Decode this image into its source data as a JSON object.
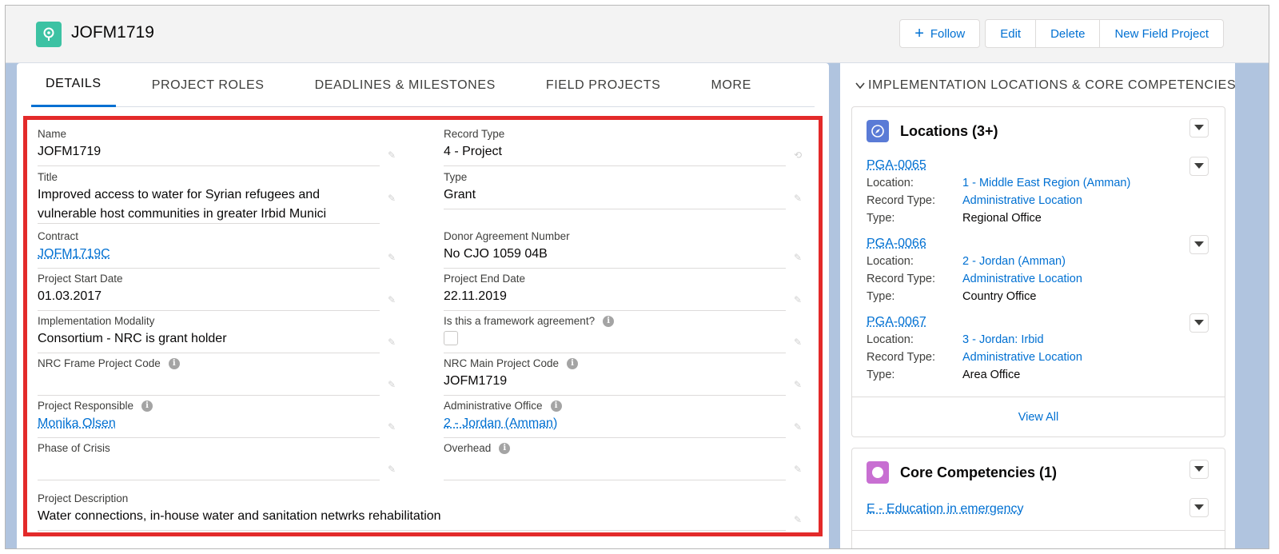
{
  "header": {
    "title": "JOFM1719",
    "buttons": {
      "follow": "Follow",
      "edit": "Edit",
      "delete": "Delete",
      "new_field_project": "New Field Project"
    }
  },
  "tabs": [
    "DETAILS",
    "PROJECT ROLES",
    "DEADLINES & MILESTONES",
    "FIELD PROJECTS",
    "MORE"
  ],
  "details": {
    "name": {
      "label": "Name",
      "value": "JOFM1719"
    },
    "record_type": {
      "label": "Record Type",
      "value": "4 - Project"
    },
    "title": {
      "label": "Title",
      "value_line1": "Improved access to water for Syrian refugees and",
      "value_line2": "vulnerable host communities in greater Irbid Munici"
    },
    "type": {
      "label": "Type",
      "value": "Grant"
    },
    "contract": {
      "label": "Contract",
      "value": "JOFM1719C"
    },
    "donor_agreement_number": {
      "label": "Donor Agreement Number",
      "value": "No CJO 1059 04B"
    },
    "project_start_date": {
      "label": "Project Start Date",
      "value": "01.03.2017"
    },
    "project_end_date": {
      "label": "Project End Date",
      "value": "22.11.2019"
    },
    "implementation_modality": {
      "label": "Implementation Modality",
      "value": "Consortium - NRC is grant holder"
    },
    "framework_agreement": {
      "label": "Is this a framework agreement?",
      "checked": false
    },
    "nrc_frame_project_code": {
      "label": "NRC Frame Project Code",
      "value": ""
    },
    "nrc_main_project_code": {
      "label": "NRC Main Project Code",
      "value": "JOFM1719"
    },
    "project_responsible": {
      "label": "Project Responsible",
      "value": "Monika Olsen"
    },
    "administrative_office": {
      "label": "Administrative Office",
      "value": "2 - Jordan (Amman)"
    },
    "phase_of_crisis": {
      "label": "Phase of Crisis",
      "value": ""
    },
    "overhead": {
      "label": "Overhead",
      "value": ""
    },
    "project_description": {
      "label": "Project Description",
      "value": "Water connections, in-house water and sanitation netwrks rehabilitation"
    }
  },
  "right": {
    "section_title": "IMPLEMENTATION LOCATIONS & CORE COMPETENCIES",
    "locations": {
      "title": "Locations (3+)",
      "labels": {
        "location": "Location:",
        "record_type": "Record Type:",
        "type": "Type:"
      },
      "items": [
        {
          "id": "PGA-0065",
          "location": "1 - Middle East Region (Amman)",
          "record_type": "Administrative Location",
          "type": "Regional Office"
        },
        {
          "id": "PGA-0066",
          "location": "2 - Jordan (Amman)",
          "record_type": "Administrative Location",
          "type": "Country Office"
        },
        {
          "id": "PGA-0067",
          "location": "3 - Jordan: Irbid",
          "record_type": "Administrative Location",
          "type": "Area Office"
        }
      ],
      "view_all": "View All"
    },
    "core_competencies": {
      "title": "Core Competencies (1)",
      "items": [
        "E - Education in emergency"
      ]
    }
  },
  "colors": {
    "brand_link": "#0070d2",
    "object_icon": "#3cc2a3",
    "locations_icon": "#5a7bd6",
    "competencies_icon": "#c86fd2",
    "highlight": "#e32a2a"
  }
}
